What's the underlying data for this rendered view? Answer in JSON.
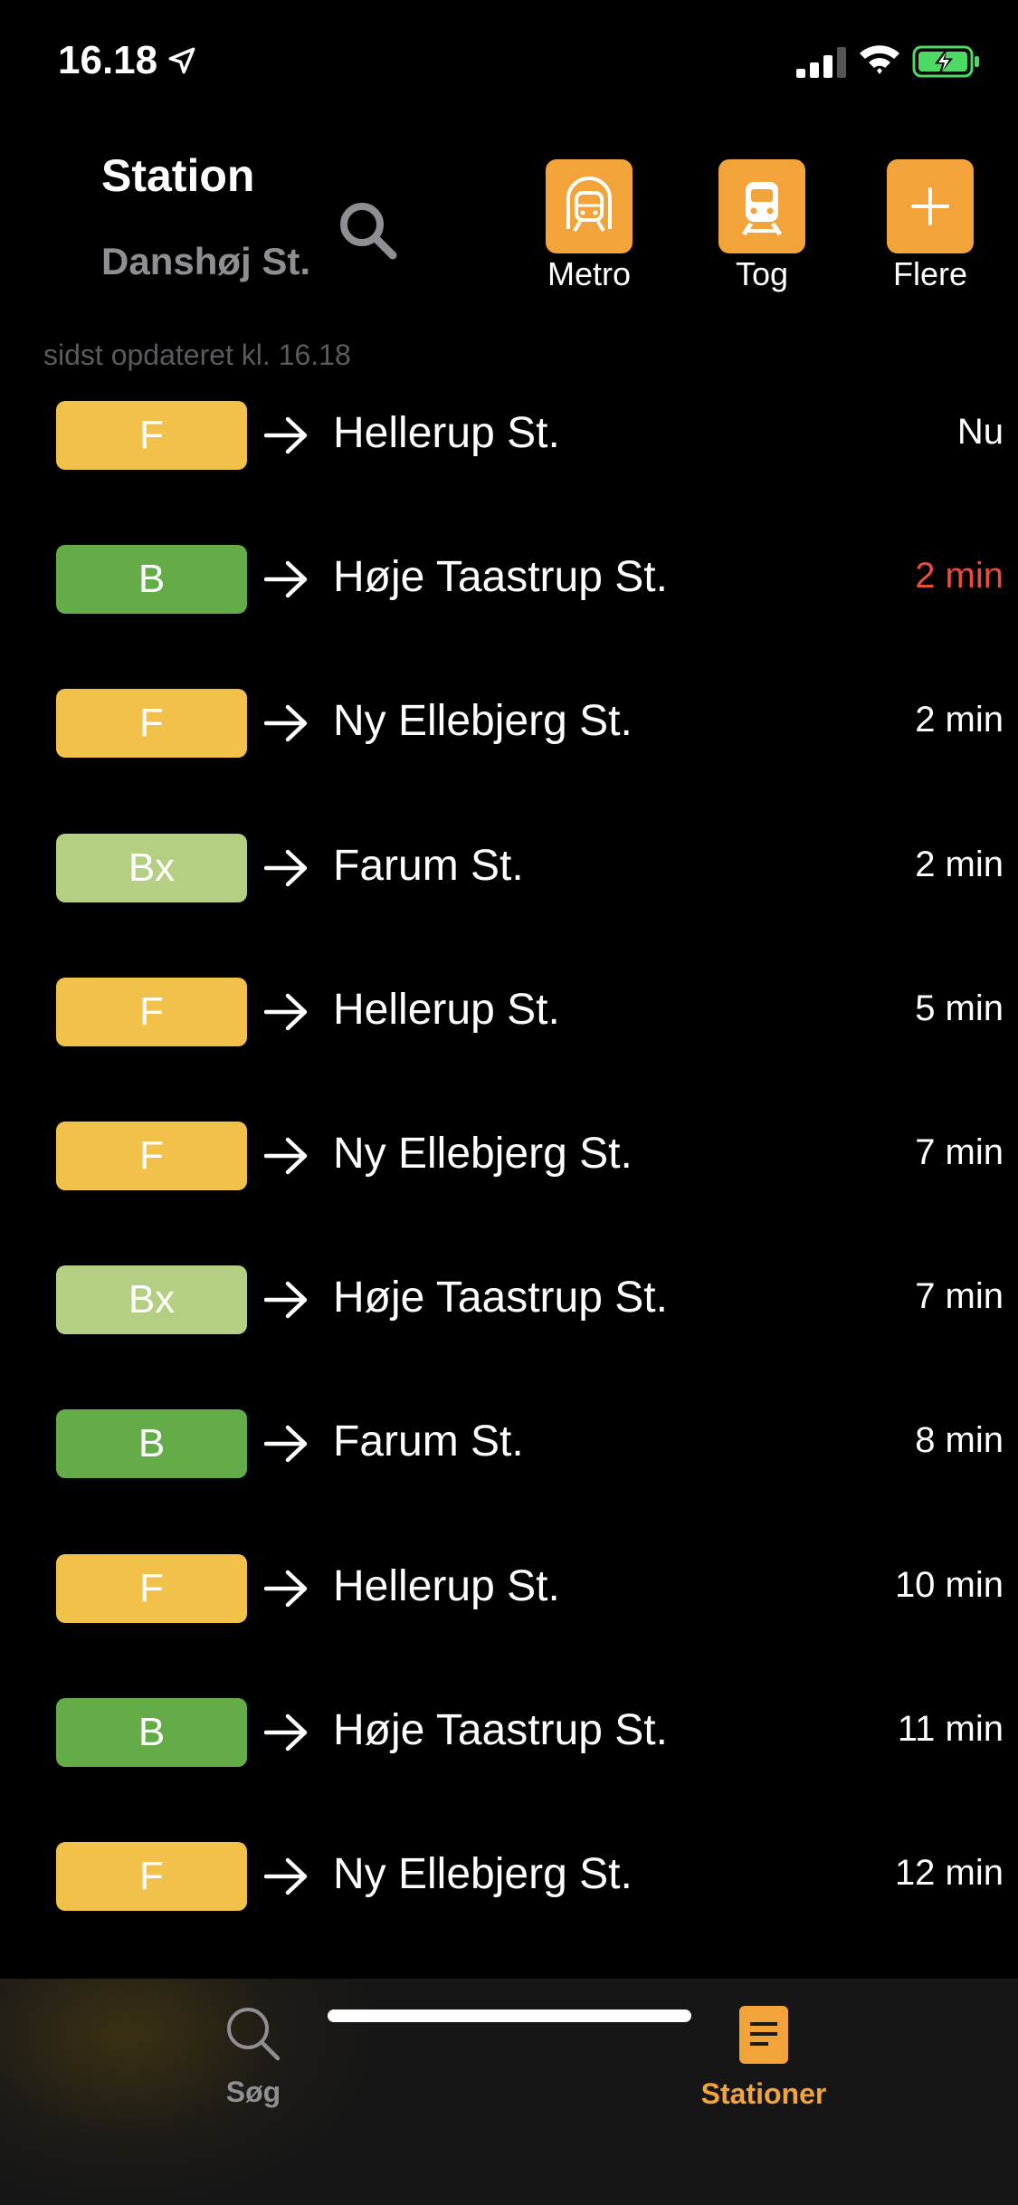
{
  "status_bar": {
    "time": "16.18"
  },
  "header": {
    "title": "Station",
    "station_name": "Danshøj St.",
    "buttons": [
      {
        "label": "Metro",
        "icon": "metro-icon"
      },
      {
        "label": "Tog",
        "icon": "train-icon"
      },
      {
        "label": "Flere",
        "icon": "plus-icon"
      }
    ]
  },
  "updated_text": "sidst opdateret kl. 16.18",
  "departures": [
    {
      "line": "F",
      "destination": "Hellerup St.",
      "time": "Nu",
      "line_color": "#f2c14a",
      "time_color": "#ffffff"
    },
    {
      "line": "B",
      "destination": "Høje Taastrup St.",
      "time": "2 min",
      "line_color": "#64ac48",
      "time_color": "#eb4d3d"
    },
    {
      "line": "F",
      "destination": "Ny Ellebjerg St.",
      "time": "2 min",
      "line_color": "#f2c14a",
      "time_color": "#ffffff"
    },
    {
      "line": "Bx",
      "destination": "Farum St.",
      "time": "2 min",
      "line_color": "#b5cf82",
      "time_color": "#ffffff"
    },
    {
      "line": "F",
      "destination": "Hellerup St.",
      "time": "5 min",
      "line_color": "#f2c14a",
      "time_color": "#ffffff"
    },
    {
      "line": "F",
      "destination": "Ny Ellebjerg St.",
      "time": "7 min",
      "line_color": "#f2c14a",
      "time_color": "#ffffff"
    },
    {
      "line": "Bx",
      "destination": "Høje Taastrup St.",
      "time": "7 min",
      "line_color": "#b5cf82",
      "time_color": "#ffffff"
    },
    {
      "line": "B",
      "destination": "Farum St.",
      "time": "8 min",
      "line_color": "#64ac48",
      "time_color": "#ffffff"
    },
    {
      "line": "F",
      "destination": "Hellerup St.",
      "time": "10 min",
      "line_color": "#f2c14a",
      "time_color": "#ffffff"
    },
    {
      "line": "B",
      "destination": "Høje Taastrup St.",
      "time": "11 min",
      "line_color": "#64ac48",
      "time_color": "#ffffff"
    },
    {
      "line": "F",
      "destination": "Ny Ellebjerg St.",
      "time": "12 min",
      "line_color": "#f2c14a",
      "time_color": "#ffffff"
    }
  ],
  "tabbar": {
    "tabs": [
      {
        "label": "Søg",
        "icon": "search-icon",
        "active": false
      },
      {
        "label": "Stationer",
        "icon": "document-icon",
        "active": true
      }
    ]
  },
  "colors": {
    "accent": "#f2a33a",
    "inactive": "#8e8e93",
    "late": "#eb4d3d"
  }
}
